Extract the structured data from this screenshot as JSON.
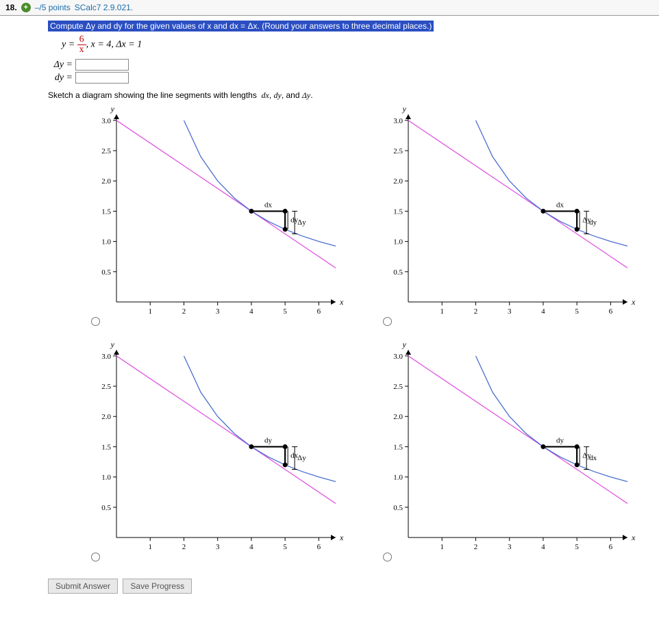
{
  "header": {
    "number": "18.",
    "icon_symbol": "+",
    "points": "–/5 points",
    "source": "SCalc7 2.9.021."
  },
  "instruction_highlight": "Compute Δy and dy for the given values of x and dx = Δx. (Round your answers to three decimal places.)",
  "equation": {
    "frac_top": "6",
    "frac_bot": "x",
    "rest": ",  x = 4,  Δx = 1"
  },
  "answers": {
    "dy_cap": "Δy =",
    "dy_low": "dy ="
  },
  "sketch_instruction": "Sketch a diagram showing the line segments with lengths  dx, dy, and Δy.",
  "chart_data": [
    {
      "type": "line",
      "xlabel": "x",
      "ylabel": "y",
      "xticks": [
        1,
        2,
        3,
        4,
        5,
        6
      ],
      "yticks": [
        0.5,
        1.0,
        1.5,
        2.0,
        2.5,
        3.0
      ],
      "xlim": [
        0,
        6.5
      ],
      "ylim": [
        0,
        3.1
      ],
      "series": [
        {
          "name": "tangent",
          "color": "#e055e0",
          "x": [
            0,
            6.5
          ],
          "y": [
            3.0,
            0.5625
          ]
        },
        {
          "name": "curve",
          "color": "#4a6ed0",
          "x": [
            2.0,
            2.5,
            3.0,
            3.5,
            4.0,
            4.5,
            5.0,
            5.5,
            6.0,
            6.5
          ],
          "y": [
            3.0,
            2.4,
            2.0,
            1.714,
            1.5,
            1.333,
            1.2,
            1.091,
            1.0,
            0.923
          ]
        }
      ],
      "points": [
        {
          "x": 4,
          "y": 1.5
        },
        {
          "x": 5,
          "y": 1.5
        },
        {
          "x": 5,
          "y": 1.2
        }
      ],
      "annotations": {
        "top": "dx",
        "left": "dy",
        "right": "Δy"
      }
    },
    {
      "type": "line",
      "xlabel": "x",
      "ylabel": "y",
      "xticks": [
        1,
        2,
        3,
        4,
        5,
        6
      ],
      "yticks": [
        0.5,
        1.0,
        1.5,
        2.0,
        2.5,
        3.0
      ],
      "xlim": [
        0,
        6.5
      ],
      "ylim": [
        0,
        3.1
      ],
      "series": [
        {
          "name": "tangent",
          "color": "#e055e0",
          "x": [
            0,
            6.5
          ],
          "y": [
            3.0,
            0.5625
          ]
        },
        {
          "name": "curve",
          "color": "#4a6ed0",
          "x": [
            2.0,
            2.5,
            3.0,
            3.5,
            4.0,
            4.5,
            5.0,
            5.5,
            6.0,
            6.5
          ],
          "y": [
            3.0,
            2.4,
            2.0,
            1.714,
            1.5,
            1.333,
            1.2,
            1.091,
            1.0,
            0.923
          ]
        }
      ],
      "points": [
        {
          "x": 4,
          "y": 1.5
        },
        {
          "x": 5,
          "y": 1.5
        },
        {
          "x": 5,
          "y": 1.2
        }
      ],
      "annotations": {
        "top": "dx",
        "left": "Δy",
        "right": "dy"
      }
    },
    {
      "type": "line",
      "xlabel": "x",
      "ylabel": "y",
      "xticks": [
        1,
        2,
        3,
        4,
        5,
        6
      ],
      "yticks": [
        0.5,
        1.0,
        1.5,
        2.0,
        2.5,
        3.0
      ],
      "xlim": [
        0,
        6.5
      ],
      "ylim": [
        0,
        3.1
      ],
      "series": [
        {
          "name": "tangent",
          "color": "#e055e0",
          "x": [
            0,
            6.5
          ],
          "y": [
            3.0,
            0.5625
          ]
        },
        {
          "name": "curve",
          "color": "#4a6ed0",
          "x": [
            2.0,
            2.5,
            3.0,
            3.5,
            4.0,
            4.5,
            5.0,
            5.5,
            6.0,
            6.5
          ],
          "y": [
            3.0,
            2.4,
            2.0,
            1.714,
            1.5,
            1.333,
            1.2,
            1.091,
            1.0,
            0.923
          ]
        }
      ],
      "points": [
        {
          "x": 4,
          "y": 1.5
        },
        {
          "x": 5,
          "y": 1.5
        },
        {
          "x": 5,
          "y": 1.2
        }
      ],
      "annotations": {
        "top": "dy",
        "left": "dx",
        "right": "Δy"
      }
    },
    {
      "type": "line",
      "xlabel": "x",
      "ylabel": "y",
      "xticks": [
        1,
        2,
        3,
        4,
        5,
        6
      ],
      "yticks": [
        0.5,
        1.0,
        1.5,
        2.0,
        2.5,
        3.0
      ],
      "xlim": [
        0,
        6.5
      ],
      "ylim": [
        0,
        3.1
      ],
      "series": [
        {
          "name": "tangent",
          "color": "#e055e0",
          "x": [
            0,
            6.5
          ],
          "y": [
            3.0,
            0.5625
          ]
        },
        {
          "name": "curve",
          "color": "#4a6ed0",
          "x": [
            2.0,
            2.5,
            3.0,
            3.5,
            4.0,
            4.5,
            5.0,
            5.5,
            6.0,
            6.5
          ],
          "y": [
            3.0,
            2.4,
            2.0,
            1.714,
            1.5,
            1.333,
            1.2,
            1.091,
            1.0,
            0.923
          ]
        }
      ],
      "points": [
        {
          "x": 4,
          "y": 1.5
        },
        {
          "x": 5,
          "y": 1.5
        },
        {
          "x": 5,
          "y": 1.2
        }
      ],
      "annotations": {
        "top": "dy",
        "left": "Δy",
        "right": "dx"
      }
    }
  ],
  "buttons": {
    "submit": "Submit Answer",
    "save": "Save Progress"
  }
}
